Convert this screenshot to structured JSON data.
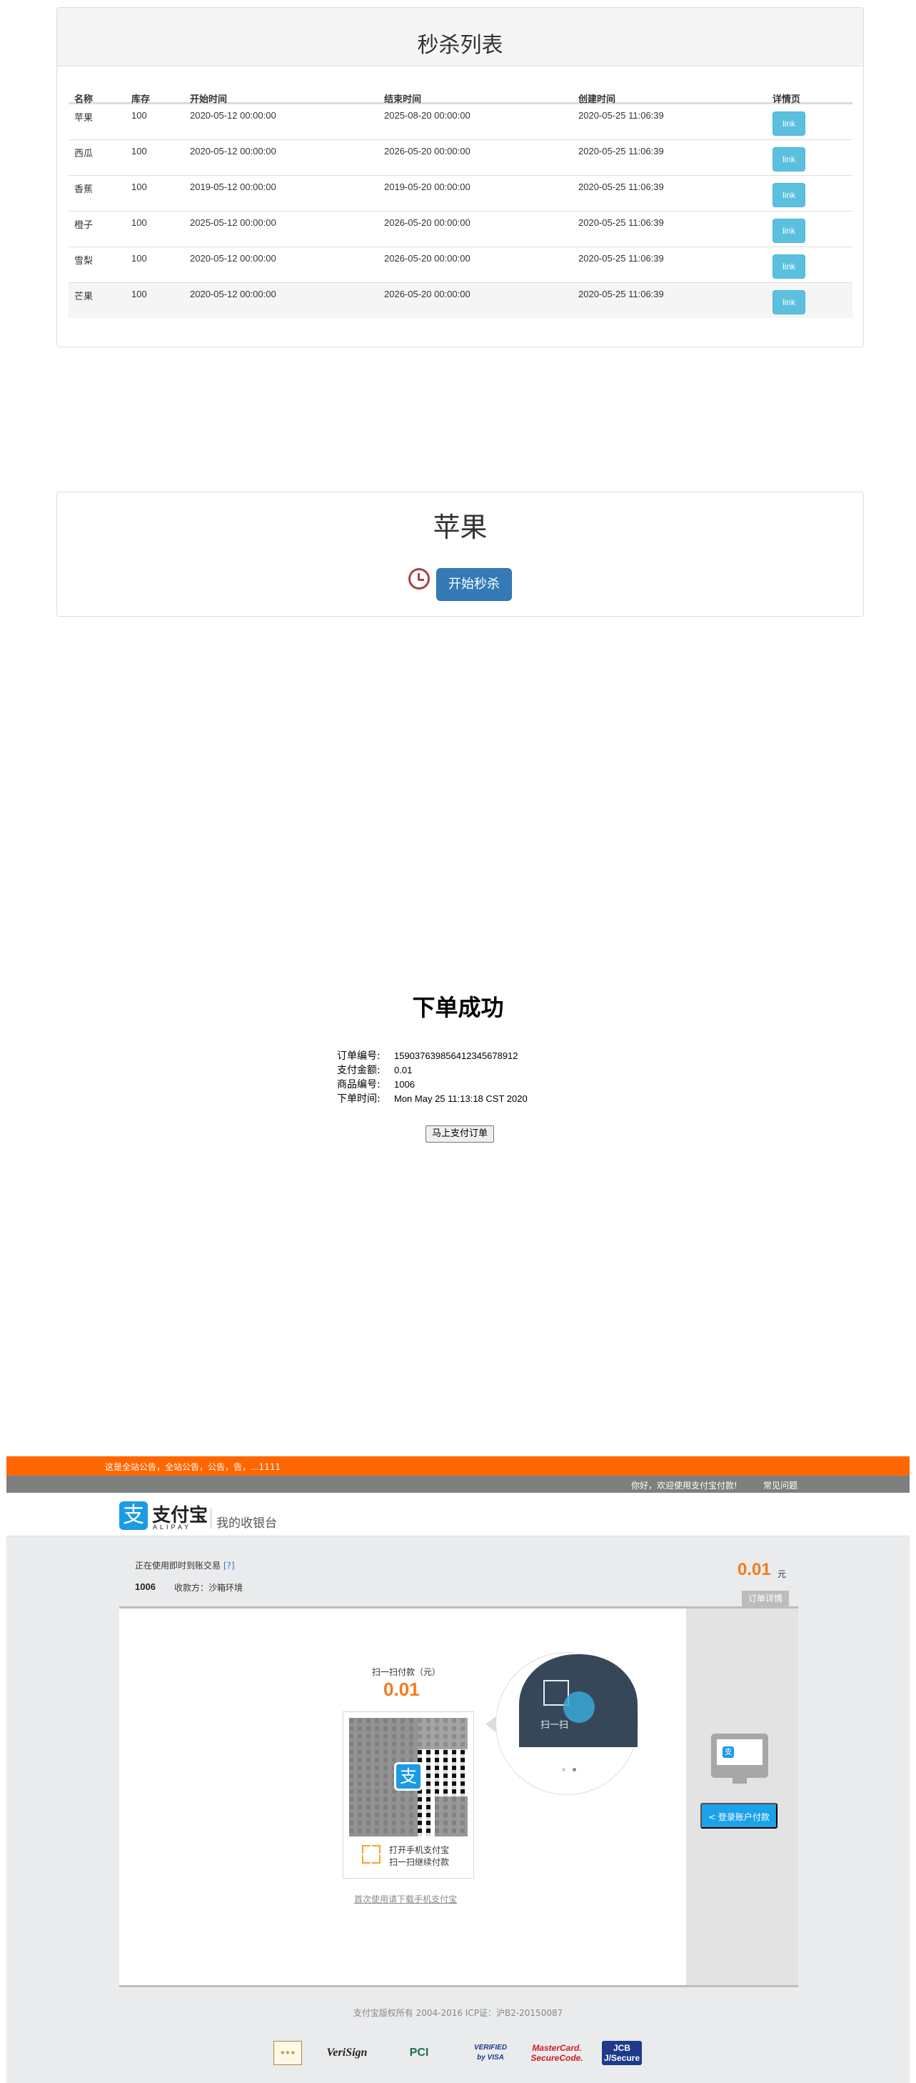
{
  "seckill_list": {
    "title": "秒杀列表",
    "columns": [
      "名称",
      "库存",
      "开始时间",
      "结束时间",
      "创建时间",
      "详情页"
    ],
    "rows": [
      {
        "name": "苹果",
        "stock": "100",
        "start": "2020-05-12 00:00:00",
        "end": "2025-08-20 00:00:00",
        "created": "2020-05-25 11:06:39",
        "link": "link"
      },
      {
        "name": "西瓜",
        "stock": "100",
        "start": "2020-05-12 00:00:00",
        "end": "2026-05-20 00:00:00",
        "created": "2020-05-25 11:06:39",
        "link": "link"
      },
      {
        "name": "香蕉",
        "stock": "100",
        "start": "2019-05-12 00:00:00",
        "end": "2019-05-20 00:00:00",
        "created": "2020-05-25 11:06:39",
        "link": "link"
      },
      {
        "name": "橙子",
        "stock": "100",
        "start": "2025-05-12 00:00:00",
        "end": "2026-05-20 00:00:00",
        "created": "2020-05-25 11:06:39",
        "link": "link"
      },
      {
        "name": "雪梨",
        "stock": "100",
        "start": "2020-05-12 00:00:00",
        "end": "2026-05-20 00:00:00",
        "created": "2020-05-25 11:06:39",
        "link": "link"
      },
      {
        "name": "芒果",
        "stock": "100",
        "start": "2020-05-12 00:00:00",
        "end": "2026-05-20 00:00:00",
        "created": "2020-05-25 11:06:39",
        "link": "link"
      }
    ]
  },
  "detail": {
    "title": "苹果",
    "start_button": "开始秒杀",
    "clock_icon": "clock-icon",
    "clock_color": "#a94442",
    "button_color": "#337ab7"
  },
  "order": {
    "title": "下单成功",
    "fields": [
      {
        "label": "订单编号:",
        "value": "159037639856412345678912"
      },
      {
        "label": "支付金额:",
        "value": "0.01"
      },
      {
        "label": "商品编号:",
        "value": "1006"
      },
      {
        "label": "下单时间:",
        "value": "Mon May 25 11:13:18 CST 2020"
      }
    ],
    "pay_button": "马上支付订单"
  },
  "alipay": {
    "notice": "这是全站公告，全站公告，公告，告，...1111",
    "welcome": "你好，欢迎使用支付宝付款!",
    "faq": "常见问题",
    "logo_char": "支",
    "logo_name": "支付宝",
    "logo_en": "ALIPAY",
    "cashier": "我的收银台",
    "using": "正在使用即时到账交易",
    "help": "[?]",
    "order_no": "1006",
    "payee": "收款方：沙箱环境",
    "amount": "0.01",
    "yuan": "元",
    "order_detail": "订单详情",
    "scan_title": "扫一扫付款（元）",
    "scan_amount": "0.01",
    "scan_tip1": "打开手机支付宝",
    "scan_tip2": "扫一扫继续付款",
    "phone_scan_label": "扫一扫",
    "download": "首次使用请下载手机支付宝",
    "login_button": "< 登录账户付款",
    "copyright": "支付宝版权所有 2004-2016 ICP证：沪B2-20150087",
    "badges": [
      "VeriSign",
      "PCI",
      "VERIFIED by VISA",
      "MasterCard. SecureCode.",
      "JCB J/Secure"
    ],
    "accent_orange": "#ff6600",
    "accent_blue": "#1ba2e8",
    "amount_color": "#f37b1d"
  }
}
